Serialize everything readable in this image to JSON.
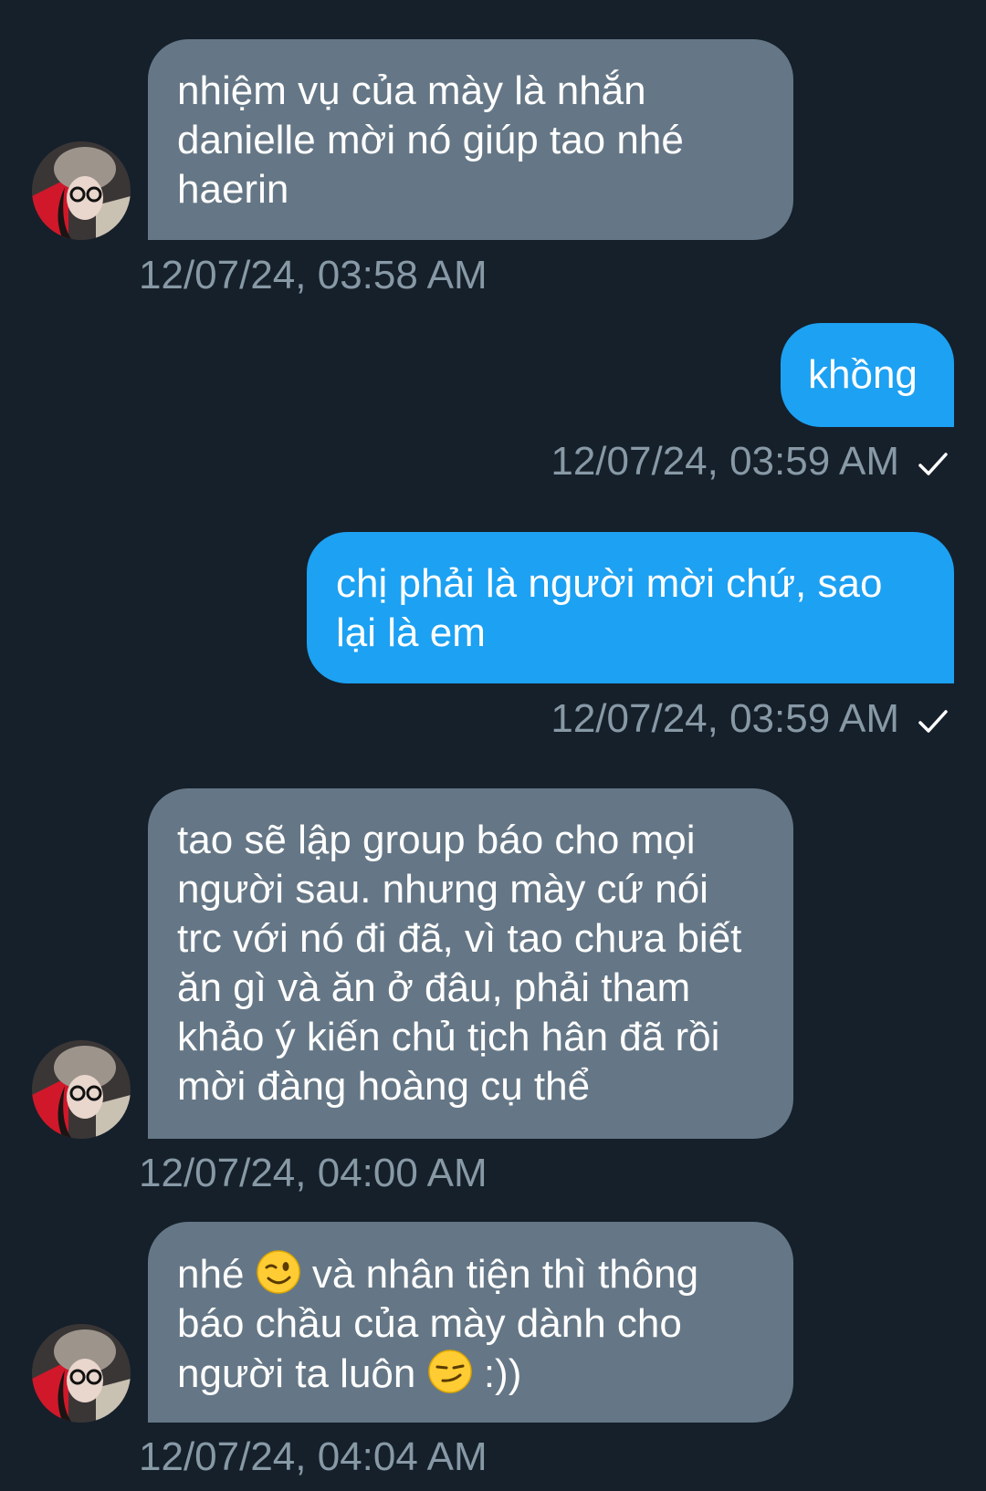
{
  "colors": {
    "background": "#15202b",
    "incoming_bubble": "#657786",
    "outgoing_bubble": "#1da1f2",
    "timestamp": "#8899a6"
  },
  "messages": [
    {
      "direction": "incoming",
      "text": "nhiệm vụ của mày là nhắn danielle mời nó giúp tao nhé haerin",
      "timestamp": "12/07/24, 03:58 AM"
    },
    {
      "direction": "outgoing",
      "text": "khồng",
      "timestamp": "12/07/24, 03:59 AM",
      "status_icon": "check-icon"
    },
    {
      "direction": "outgoing",
      "text": "chị phải là người mời chứ, sao lại là em",
      "timestamp": "12/07/24, 03:59 AM",
      "status_icon": "check-icon"
    },
    {
      "direction": "incoming",
      "text": "tao sẽ lập group báo cho mọi người sau. nhưng mày cứ nói trc với nó đi đã, vì tao chưa biết ăn gì và ăn ở đâu, phải tham khảo ý kiến chủ tịch hân đã rồi mời đàng hoàng cụ thể",
      "timestamp": "12/07/24, 04:00 AM"
    },
    {
      "direction": "incoming",
      "text_part1": "nhé",
      "emoji1": "winking-face-emoji",
      "text_part2": "và nhân tiện thì thông báo chầu của mày dành cho người ta luôn",
      "emoji2": "smirking-face-emoji",
      "text_part3": ":))",
      "timestamp": "12/07/24, 04:04 AM"
    }
  ]
}
